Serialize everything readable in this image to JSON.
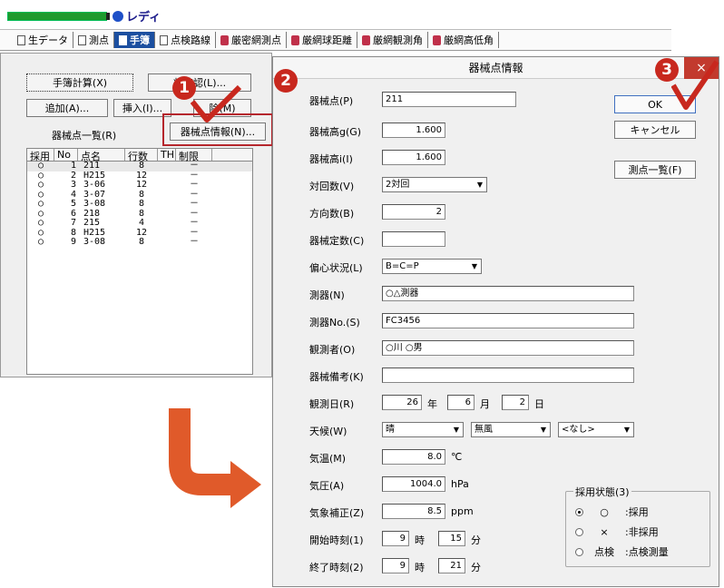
{
  "app": {
    "title": "レディ"
  },
  "tabs": [
    {
      "label": "生データ",
      "icon": "doc-icon",
      "active": false
    },
    {
      "label": "測点",
      "icon": "doc-icon",
      "active": false
    },
    {
      "label": "手簿",
      "icon": "doc-icon",
      "active": true
    },
    {
      "label": "点検路線",
      "icon": "doc-icon",
      "active": false
    },
    {
      "label": "厳密網測点",
      "icon": "cylinder-icon",
      "active": false
    },
    {
      "label": "厳網球距離",
      "icon": "cylinder-icon",
      "active": false
    },
    {
      "label": "厳網観測角",
      "icon": "cylinder-icon",
      "active": false
    },
    {
      "label": "厳網高低角",
      "icon": "cylinder-icon",
      "active": false
    }
  ],
  "left": {
    "calc_btn": "手簿計算(X)",
    "check_btn": "状確認(L)...",
    "add_btn": "追加(A)...",
    "insert_btn": "挿入(I)...",
    "delete_btn": "除(M)",
    "info_btn": "器械点情報(N)...",
    "list_title": "器械点一覧(R)",
    "columns": [
      "採用",
      "No",
      "点名",
      "行数",
      "TH",
      "制限"
    ],
    "rows": [
      {
        "use": "○",
        "no": "1",
        "name": "211",
        "lines": "8",
        "limit": "－"
      },
      {
        "use": "○",
        "no": "2",
        "name": "H215",
        "lines": "12",
        "limit": "－"
      },
      {
        "use": "○",
        "no": "3",
        "name": "3-06",
        "lines": "12",
        "limit": "－"
      },
      {
        "use": "○",
        "no": "4",
        "name": "3-07",
        "lines": "8",
        "limit": "－"
      },
      {
        "use": "○",
        "no": "5",
        "name": "3-08",
        "lines": "8",
        "limit": "－"
      },
      {
        "use": "○",
        "no": "6",
        "name": "218",
        "lines": "8",
        "limit": "－"
      },
      {
        "use": "○",
        "no": "7",
        "name": "215",
        "lines": "4",
        "limit": "－"
      },
      {
        "use": "○",
        "no": "8",
        "name": "H215",
        "lines": "12",
        "limit": "－"
      },
      {
        "use": "○",
        "no": "9",
        "name": "3-08",
        "lines": "8",
        "limit": "－"
      }
    ]
  },
  "dialog": {
    "title": "器械点情報",
    "close": "×",
    "ok": "OK",
    "cancel": "キャンセル",
    "point_list": "測点一覧(F)",
    "fields": {
      "station_label": "器械点(P)",
      "station": "211",
      "height_g_label": "器械高g(G)",
      "height_g": "1.600",
      "height_i_label": "器械高i(I)",
      "height_i": "1.600",
      "rounds_label": "対回数(V)",
      "rounds": "2対回",
      "directions_label": "方向数(B)",
      "directions": "2",
      "constant_label": "器械定数(C)",
      "constant": "",
      "eccentric_label": "偏心状況(L)",
      "eccentric": "B=C=P",
      "instrument_label": "測器(N)",
      "instrument": "○△測器",
      "instrument_no_label": "測器No.(S)",
      "instrument_no": "FC3456",
      "observer_label": "観測者(O)",
      "observer": "○川 ○男",
      "remarks_label": "器械備考(K)",
      "remarks": "",
      "date_label": "観測日(R)",
      "year": "26",
      "year_unit": "年",
      "month": "6",
      "month_unit": "月",
      "day": "2",
      "day_unit": "日",
      "weather_label": "天候(W)",
      "weather": "晴",
      "wind": "無風",
      "weather_extra": "<なし>",
      "temp_label": "気温(M)",
      "temp": "8.0",
      "temp_unit": "℃",
      "pressure_label": "気圧(A)",
      "pressure": "1004.0",
      "pressure_unit": "hPa",
      "correction_label": "気象補正(Z)",
      "correction": "8.5",
      "correction_unit": "ppm",
      "start_label": "開始時刻(1)",
      "start_h": "9",
      "start_m": "15",
      "end_label": "終了時刻(2)",
      "end_h": "9",
      "end_m": "21",
      "hour_unit": "時",
      "minute_unit": "分"
    },
    "status_group": {
      "title": "採用状態(3)",
      "options": [
        {
          "symbol": "○",
          "text": ":採用",
          "selected": true
        },
        {
          "symbol": "×",
          "text": ":非採用",
          "selected": false
        },
        {
          "symbol": "点検",
          "text": ":点検測量",
          "selected": false
        }
      ]
    }
  },
  "steps": {
    "one": "1",
    "two": "2",
    "three": "3"
  },
  "colors": {
    "accent": "#c8281e",
    "tab_active": "#1c4fa0",
    "arrow": "#e05a2a"
  }
}
